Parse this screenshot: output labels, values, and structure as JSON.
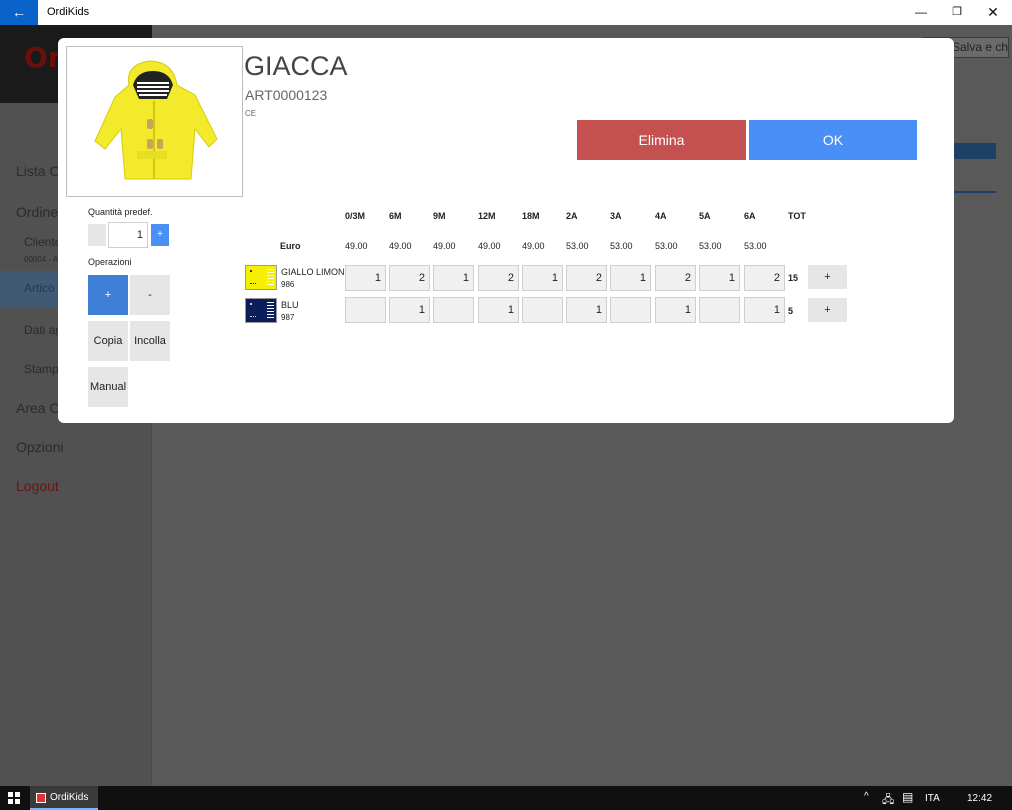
{
  "window": {
    "title": "OrdiKids",
    "back_icon": "←",
    "minimize": "—",
    "maximize": "❐",
    "close": "✕"
  },
  "app": {
    "logo": "Or",
    "sidebar": [
      {
        "label": "Lista Or",
        "kind": "item"
      },
      {
        "label": "Ordine",
        "kind": "item"
      },
      {
        "label": "Cliente",
        "kind": "sub"
      },
      {
        "label": "00004 - A",
        "kind": "tiny"
      },
      {
        "label": "Artico",
        "kind": "active"
      },
      {
        "label": "Dati ag",
        "kind": "sub"
      },
      {
        "label": "Stampa",
        "kind": "sub"
      },
      {
        "label": "Area Or",
        "kind": "item"
      },
      {
        "label": "Opzioni",
        "kind": "item"
      },
      {
        "label": "Logout",
        "kind": "logout"
      }
    ],
    "top_right_button": "Salva e chiudi"
  },
  "dialog": {
    "title": "GIACCA",
    "code": "ART0000123",
    "note": "CE",
    "delete_label": "Elimina",
    "ok_label": "OK",
    "qty_label": "Quantità predef.",
    "qty_value": "1",
    "qty_plus": "+",
    "operations_label": "Operazioni",
    "op_plus": "+",
    "op_minus": "-",
    "op_copy": "Copia",
    "op_paste": "Incolla",
    "op_manual": "Manual",
    "sizes": [
      "0/3M",
      "6M",
      "9M",
      "12M",
      "18M",
      "2A",
      "3A",
      "4A",
      "5A",
      "6A"
    ],
    "tot_label": "TOT",
    "euro_label": "Euro",
    "prices": [
      "49.00",
      "49.00",
      "49.00",
      "49.00",
      "49.00",
      "53.00",
      "53.00",
      "53.00",
      "53.00",
      "53.00"
    ],
    "colors": [
      {
        "name": "GIALLO LIMONE",
        "code": "986",
        "quantities": [
          "1",
          "2",
          "1",
          "2",
          "1",
          "2",
          "1",
          "2",
          "1",
          "2"
        ],
        "total": "15",
        "add_label": "+",
        "swatch": "#f5f000"
      },
      {
        "name": "BLU",
        "code": "987",
        "quantities": [
          "",
          "1",
          "",
          "1",
          "",
          "1",
          "",
          "1",
          "",
          "1"
        ],
        "total": "5",
        "add_label": "+",
        "swatch": "#0d1d5a"
      }
    ]
  },
  "taskbar": {
    "app_label": "OrdiKids",
    "tray_up": "^",
    "language": "ITA",
    "time": "12:42"
  },
  "colors": {
    "accent": "#4a8ff5",
    "danger": "#c55050",
    "titlebar_back": "#0a63c8"
  }
}
